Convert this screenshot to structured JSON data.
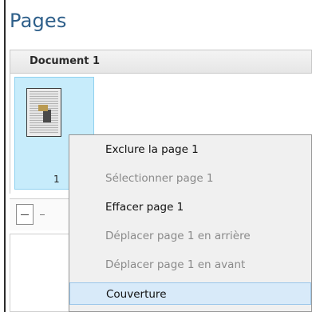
{
  "panel": {
    "title": "Pages"
  },
  "document": {
    "label": "Document 1"
  },
  "thumbnail": {
    "page_number": "1",
    "selected": true
  },
  "context_menu": {
    "items": [
      {
        "label": "Exclure la page 1",
        "enabled": true
      },
      {
        "label": "Sélectionner page 1",
        "enabled": false
      },
      {
        "label": "Effacer page 1",
        "enabled": true
      },
      {
        "label": "Déplacer page 1 en arrière",
        "enabled": false
      },
      {
        "label": "Déplacer page 1 en avant",
        "enabled": false
      },
      {
        "label": "Couverture",
        "enabled": true,
        "hovered": true
      }
    ]
  },
  "colors": {
    "title": "#2e5f8a",
    "selection": "#c7ecfb",
    "menu_hover": "#d8eaf9"
  }
}
